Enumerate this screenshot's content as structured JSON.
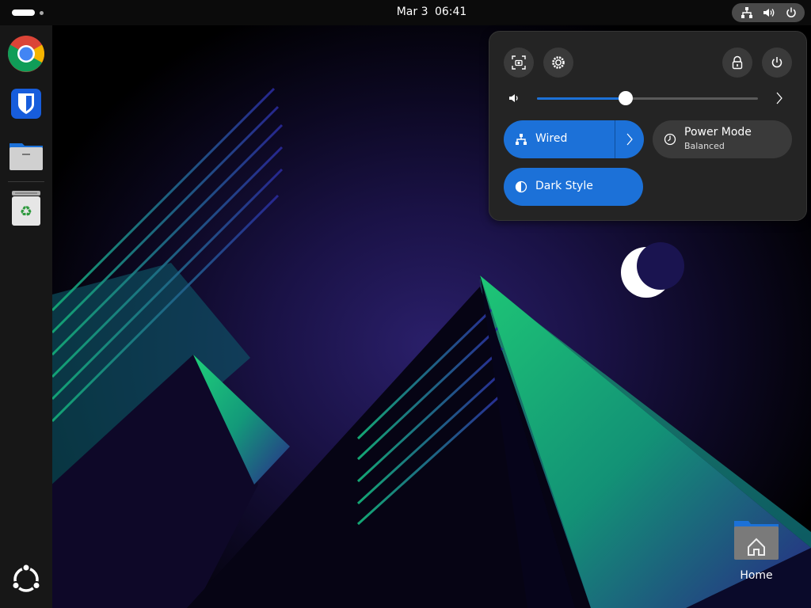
{
  "topbar": {
    "date": "Mar 3",
    "time": "06:41",
    "status_icons": [
      "network-wired-icon",
      "volume-icon",
      "power-icon"
    ]
  },
  "dock": {
    "apps": [
      {
        "name": "Google Chrome",
        "icon": "chrome-icon"
      },
      {
        "name": "Bitwarden",
        "icon": "bitwarden-icon"
      },
      {
        "name": "Files",
        "icon": "files-icon"
      },
      {
        "name": "Trash",
        "icon": "trash-icon"
      }
    ],
    "show_apps_icon": "ubuntu-logo-icon"
  },
  "desktop": {
    "home_label": "Home"
  },
  "quick_settings": {
    "buttons": [
      "screenshot-icon",
      "settings-icon",
      "lock-icon",
      "power-icon"
    ],
    "volume": 0.4,
    "wired_label": "Wired",
    "power_mode_label": "Power Mode",
    "power_mode_value": "Balanced",
    "dark_style_label": "Dark Style"
  },
  "colors": {
    "accent": "#1c71d8",
    "panel_bg": "#242424",
    "topbar_bg": "#0b0b0b",
    "dock_bg": "#171717"
  }
}
